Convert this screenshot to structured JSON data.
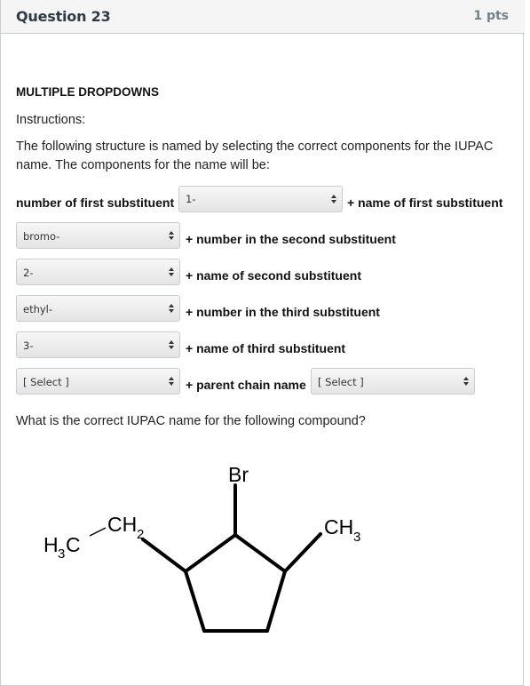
{
  "header": {
    "title": "Question 23",
    "points": "1 pts"
  },
  "question": {
    "type_label": "MULTIPLE DROPDOWNS",
    "instructions_label": "Instructions:",
    "paragraph": "The following structure is named by selecting the correct components for the IUPAC name. The components for the name will be:",
    "prompt": "What is the correct IUPAC name for the following compound?"
  },
  "labels": {
    "first_number": "number of first substituent",
    "first_name": "+ name of first substituent",
    "second_number": "+ number in the second substituent",
    "second_name": "+ name of second substituent",
    "third_number": "+ number in the third substituent",
    "third_name": "+ name of third substituent",
    "parent_chain": "+ parent chain name"
  },
  "dropdowns": {
    "d1": "1-",
    "d2": "bromo-",
    "d3": "2-",
    "d4": "ethyl-",
    "d5": "3-",
    "d6": "[ Select ]",
    "d7": "[ Select ]"
  },
  "structure": {
    "br": "Br",
    "left_h": "H",
    "left_sub": "3",
    "left_c": "C",
    "ch": "CH",
    "ch_sub": "2",
    "right_ch": "CH",
    "right_sub": "3"
  }
}
